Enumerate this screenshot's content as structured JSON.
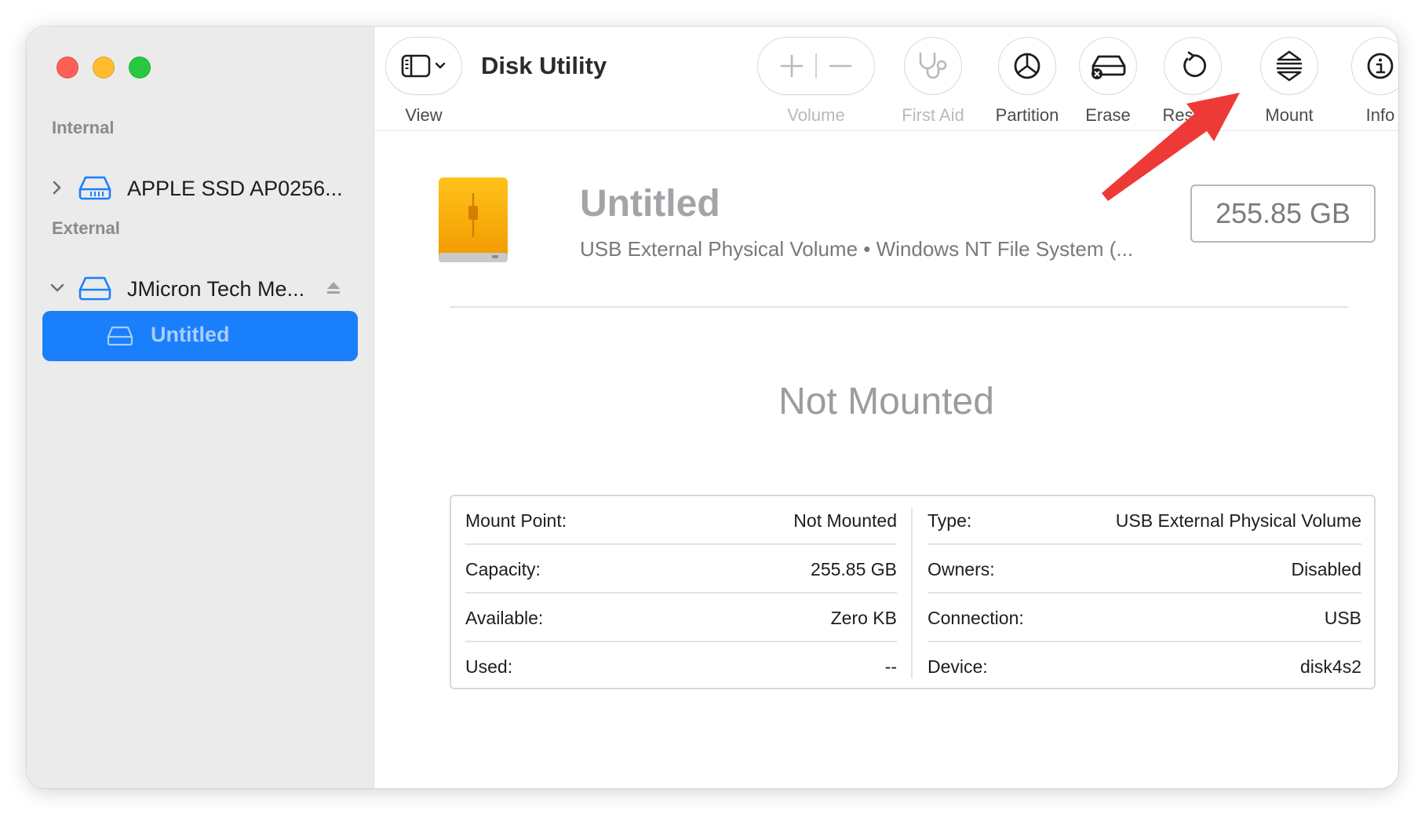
{
  "app_title": "Disk Utility",
  "toolbar": {
    "view_label": "View",
    "volume_label": "Volume",
    "first_aid_label": "First Aid",
    "partition_label": "Partition",
    "erase_label": "Erase",
    "restore_label": "Restore",
    "mount_label": "Mount",
    "info_label": "Info"
  },
  "sidebar": {
    "internal_header": "Internal",
    "external_header": "External",
    "items": [
      {
        "label": "APPLE SSD AP0256...",
        "icon": "internal-disk-icon",
        "expanded": false
      },
      {
        "label": "JMicron Tech Me...",
        "icon": "external-disk-icon",
        "expanded": true
      },
      {
        "label": "Untitled",
        "icon": "volume-icon",
        "selected": true
      }
    ]
  },
  "volume": {
    "name": "Untitled",
    "description": "USB External Physical Volume • Windows NT File System (...",
    "capacity": "255.85 GB",
    "status": "Not Mounted"
  },
  "info": {
    "left": [
      {
        "key": "Mount Point:",
        "value": "Not Mounted"
      },
      {
        "key": "Capacity:",
        "value": "255.85 GB"
      },
      {
        "key": "Available:",
        "value": "Zero KB"
      },
      {
        "key": "Used:",
        "value": "--"
      }
    ],
    "right": [
      {
        "key": "Type:",
        "value": "USB External Physical Volume"
      },
      {
        "key": "Owners:",
        "value": "Disabled"
      },
      {
        "key": "Connection:",
        "value": "USB"
      },
      {
        "key": "Device:",
        "value": "disk4s2"
      }
    ]
  },
  "colors": {
    "accent": "#1a7ffb",
    "annotation_arrow": "#ee3a36",
    "drive_orange": "#f6a800"
  }
}
